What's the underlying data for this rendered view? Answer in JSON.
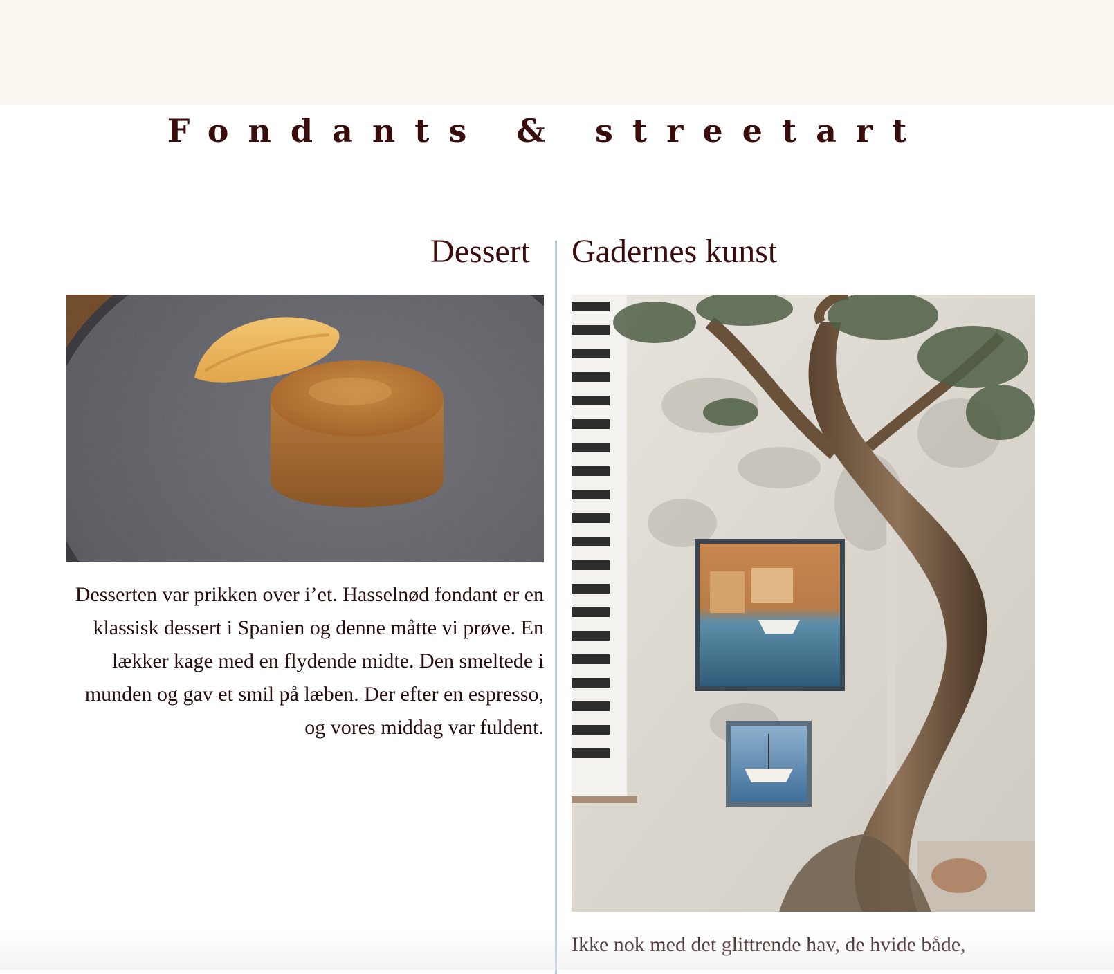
{
  "page": {
    "title": "Fondants & streetart"
  },
  "dessert": {
    "heading": "Dessert",
    "text": "Desserten var prikken over i’et. Hasselnød fondant er en klassisk dessert i Spanien og denne måtte vi prøve. En lækker kage med en flydende midte. Den smeltede i munden og gav et smil på læben. Der efter en espresso, og vores middag var fuldent."
  },
  "street": {
    "heading": "Gadernes kunst",
    "text_visible_line": "Ikke nok med det glittrende hav, de hvide både,"
  }
}
